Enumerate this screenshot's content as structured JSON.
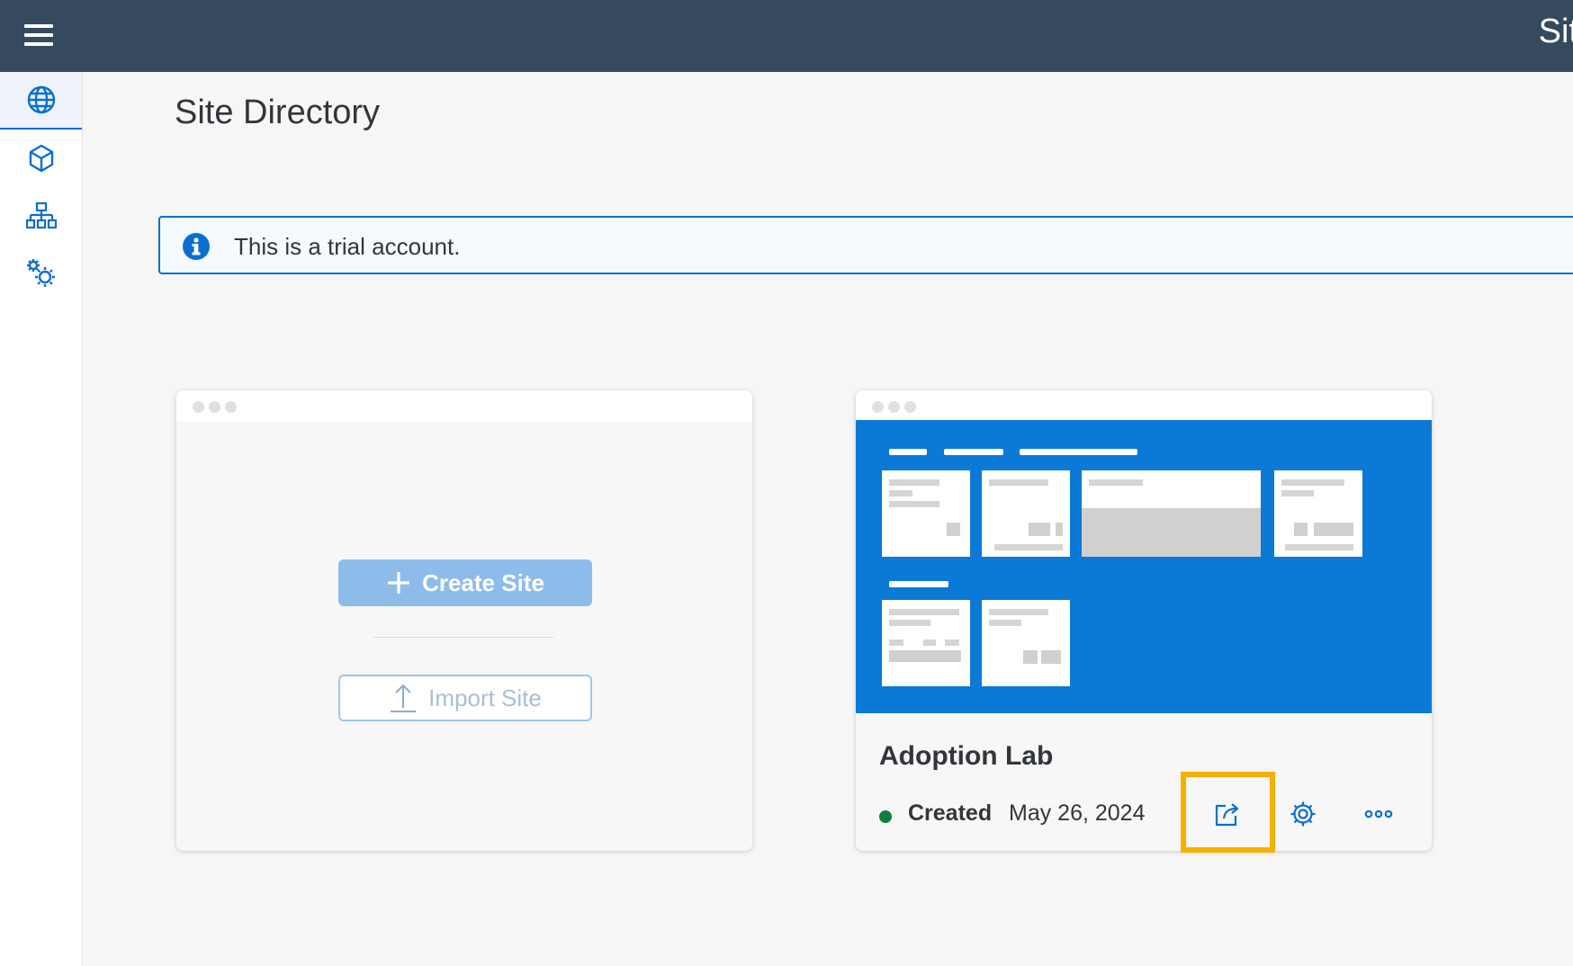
{
  "header": {
    "title": "Sit",
    "menu_icon": "hamburger-menu-icon"
  },
  "sidenav": {
    "items": [
      {
        "id": "sites",
        "icon": "globe-icon",
        "selected": true
      },
      {
        "id": "content",
        "icon": "cube-icon",
        "selected": false
      },
      {
        "id": "hierarchy",
        "icon": "org-chart-icon",
        "selected": false
      },
      {
        "id": "settings",
        "icon": "gears-icon",
        "selected": false
      }
    ]
  },
  "page": {
    "title": "Site Directory"
  },
  "message_strip": {
    "type": "information",
    "icon": "info-icon",
    "text": "This is a trial account."
  },
  "create_card": {
    "create_label": "Create Site",
    "import_label": "Import Site"
  },
  "site_card": {
    "name": "Adoption Lab",
    "status": "Created",
    "date": "May 26, 2024",
    "actions": [
      {
        "id": "open",
        "icon": "open-external-icon",
        "highlighted": true
      },
      {
        "id": "settings",
        "icon": "gear-icon",
        "highlighted": false
      },
      {
        "id": "more",
        "icon": "overflow-icon",
        "highlighted": false
      }
    ]
  },
  "colors": {
    "shell": "#354a5f",
    "brand_blue": "#0a6ed1",
    "preview_blue": "#0a7ad6",
    "status_green": "#107e3e",
    "highlight": "#f5b000"
  }
}
